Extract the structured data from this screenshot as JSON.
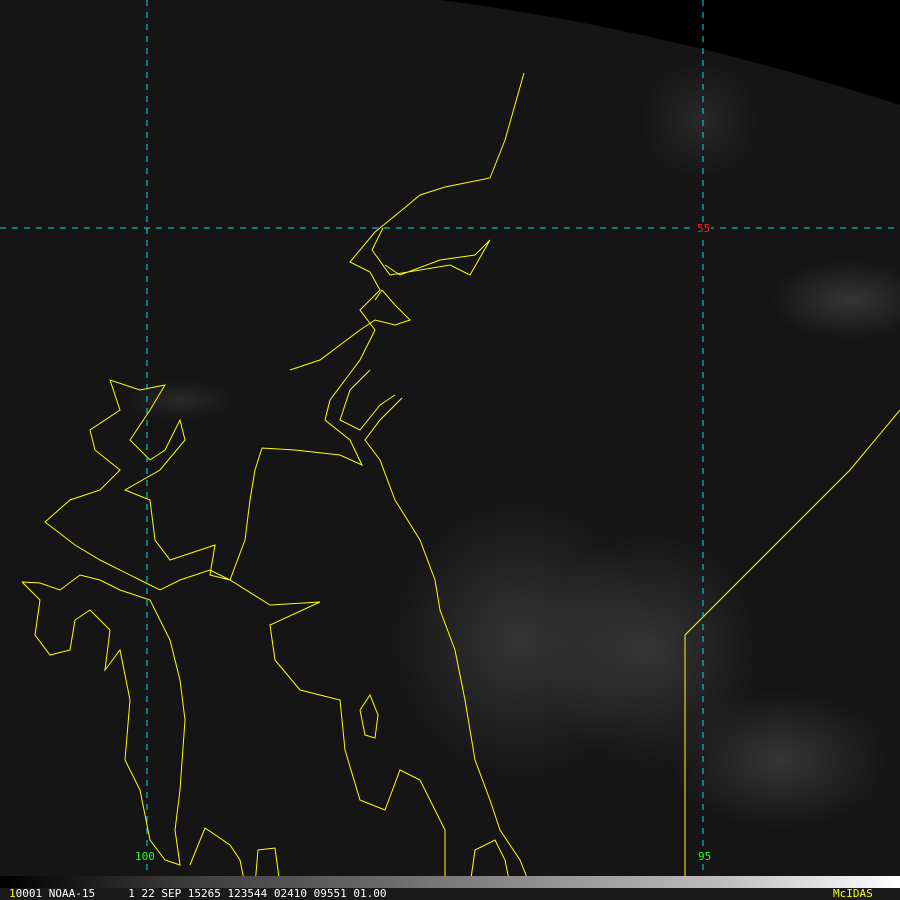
{
  "image": {
    "source_label": "McIDAS",
    "frame_number": "1",
    "info_line": "0001 NOAA-15     1 22 SEP 15265 123544 02410 09551 01.00"
  },
  "grid": {
    "latitude_label": "55",
    "longitude_labels": [
      "100",
      "95"
    ]
  },
  "colors": {
    "coastline": "#ffff00",
    "gridline": "#00e5e5",
    "lat_label": "#ff2020",
    "lon_label": "#20ff20",
    "mcidas_label": "#ffff00"
  }
}
